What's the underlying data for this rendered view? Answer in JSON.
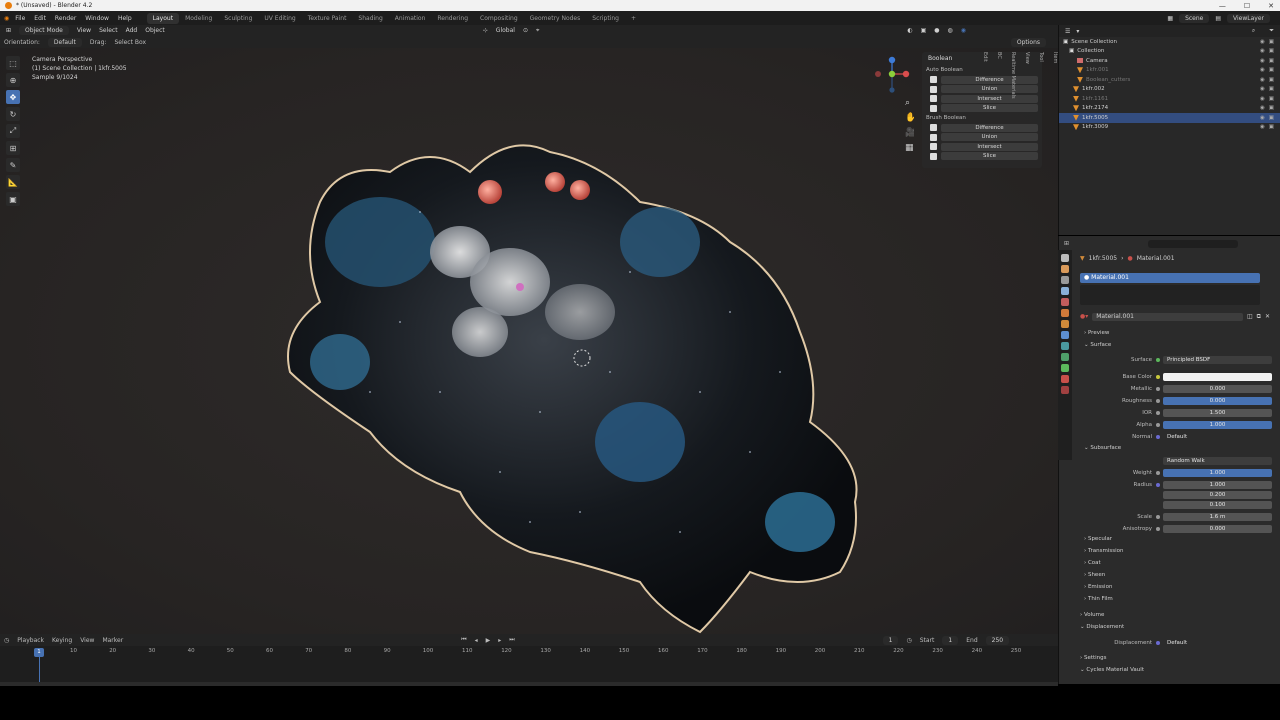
{
  "window": {
    "title": "* (Unsaved) - Blender 4.2"
  },
  "menu": [
    "File",
    "Edit",
    "Render",
    "Window",
    "Help"
  ],
  "workspaces": [
    "Layout",
    "Modeling",
    "Sculpting",
    "UV Editing",
    "Texture Paint",
    "Shading",
    "Animation",
    "Rendering",
    "Compositing",
    "Geometry Nodes",
    "Scripting"
  ],
  "active_workspace": "Layout",
  "scene": "Scene",
  "view_layer": "ViewLayer",
  "viewport_header": {
    "mode": "Object Mode",
    "menus": [
      "View",
      "Select",
      "Add",
      "Object"
    ],
    "orientation": "Global",
    "options": "Options"
  },
  "tool_settings": {
    "orientation_label": "Orientation:",
    "orientation_value": "Default",
    "drag_label": "Drag:",
    "drag_value": "Select Box"
  },
  "viewport_info": {
    "line1": "Camera Perspective",
    "line2": "(1) Scene Collection | 1kfr.5005",
    "line3": "Sample 9/1024"
  },
  "npanel": {
    "title": "Boolean",
    "auto_label": "Auto Boolean",
    "auto_ops": [
      "Difference",
      "Union",
      "Intersect",
      "Slice"
    ],
    "brush_label": "Brush Boolean",
    "brush_ops": [
      "Difference",
      "Union",
      "Intersect",
      "Slice"
    ],
    "tabs": [
      "Item",
      "Tool",
      "View",
      "Realtime Materials",
      "BC",
      "Edit"
    ]
  },
  "outliner": {
    "rows": [
      {
        "label": "Scene Collection",
        "kind": "collection"
      },
      {
        "label": "Collection",
        "kind": "collection"
      },
      {
        "label": "Camera",
        "kind": "camera"
      },
      {
        "label": "1kfr.001",
        "kind": "hidden"
      },
      {
        "label": "Boolean_cutters",
        "kind": "hidden"
      },
      {
        "label": "1kfr.002",
        "kind": "object"
      },
      {
        "label": "1kfr.1161",
        "kind": "hidden"
      },
      {
        "label": "1kfr.2174",
        "kind": "object"
      },
      {
        "label": "1kfr.5005",
        "kind": "selected"
      },
      {
        "label": "1kfr.3009",
        "kind": "object"
      }
    ]
  },
  "properties": {
    "breadcrumb_obj": "1kfr.5005",
    "breadcrumb_mat": "Material.001",
    "slot": "Material.001",
    "material_name": "Material.001",
    "sections": {
      "preview": "Preview",
      "surface": "Surface",
      "subsurface": "Subsurface",
      "collapsed": [
        "Specular",
        "Transmission",
        "Coat",
        "Sheen",
        "Emission",
        "Thin Film"
      ],
      "volume": "Volume",
      "displacement": "Displacement",
      "settings": "Settings",
      "vault": "Cycles Material Vault"
    },
    "surface": {
      "label": "Surface",
      "value": "Principled BSDF"
    },
    "base_color": {
      "label": "Base Color"
    },
    "metallic": {
      "label": "Metallic",
      "value": "0.000"
    },
    "roughness": {
      "label": "Roughness",
      "value": "0.000"
    },
    "ior": {
      "label": "IOR",
      "value": "1.500"
    },
    "alpha": {
      "label": "Alpha",
      "value": "1.000"
    },
    "normal": {
      "label": "Normal",
      "value": "Default"
    },
    "sss_method": "Random Walk",
    "weight": {
      "label": "Weight",
      "value": "1.000"
    },
    "radius": {
      "label": "Radius",
      "values": [
        "1.000",
        "0.200",
        "0.100"
      ]
    },
    "scale": {
      "label": "Scale",
      "value": "1.6 m"
    },
    "anisotropy": {
      "label": "Anisotropy",
      "value": "0.000"
    },
    "displacement": {
      "label": "Displacement",
      "value": "Default"
    }
  },
  "timeline": {
    "menus": [
      "Playback",
      "Keying",
      "View",
      "Marker"
    ],
    "current_frame": "1",
    "start_label": "Start",
    "start": "1",
    "end_label": "End",
    "end": "250",
    "ticks": [
      "10",
      "20",
      "30",
      "40",
      "50",
      "60",
      "70",
      "80",
      "90",
      "100",
      "110",
      "120",
      "130",
      "140",
      "150",
      "160",
      "170",
      "180",
      "190",
      "200",
      "210",
      "220",
      "230",
      "240",
      "250"
    ]
  },
  "colors": {
    "accent": "#4772b3",
    "selection": "#334d80",
    "bg": "#232323"
  }
}
